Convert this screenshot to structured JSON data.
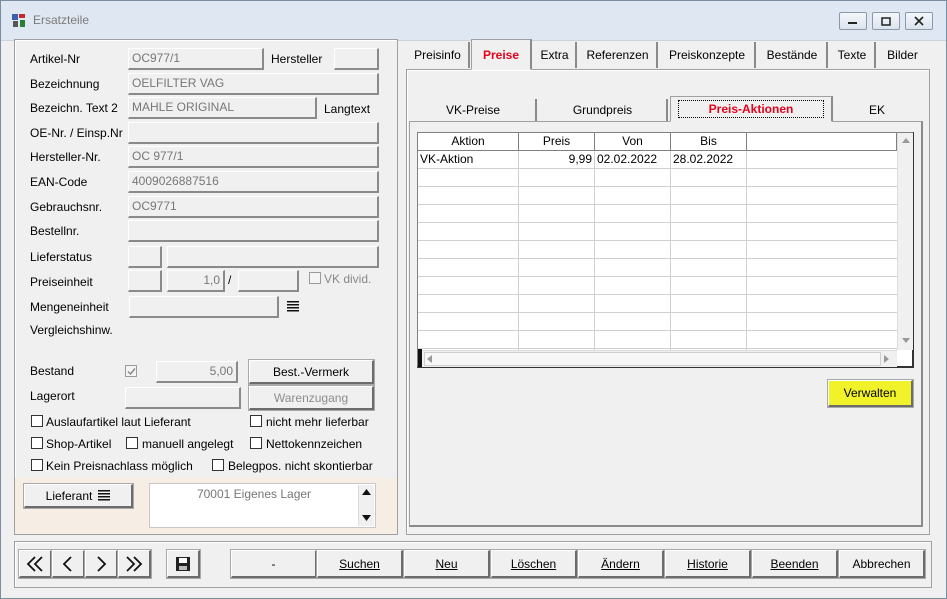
{
  "window": {
    "title": "Ersatzteile"
  },
  "left": {
    "labels": {
      "artikel_nr": "Artikel-Nr",
      "hersteller": "Hersteller",
      "bezeichnung": "Bezeichnung",
      "bezeichn_text2": "Bezeichn. Text 2",
      "langtext": "Langtext",
      "oe_nr": "OE-Nr. / Einsp.Nr",
      "hersteller_nr": "Hersteller-Nr.",
      "ean_code": "EAN-Code",
      "gebrauchsnr": "Gebrauchsnr.",
      "bestellnr": "Bestellnr.",
      "lieferstatus": "Lieferstatus",
      "preiseinheit": "Preiseinheit",
      "slash": "/",
      "vk_divid": "VK divid.",
      "mengeneinheit": "Mengeneinheit",
      "vergleichshinw": "Vergleichshinw.",
      "bestand": "Bestand",
      "lagerort": "Lagerort"
    },
    "values": {
      "artikel_nr": "OC977/1",
      "hersteller": "",
      "bezeichnung": "OELFILTER VAG",
      "bezeichn_text2": "MAHLE ORIGINAL",
      "oe_nr": "",
      "hersteller_nr": "OC 977/1",
      "ean_code": "4009026887516",
      "gebrauchsnr": "OC9771",
      "bestellnr": "",
      "lieferstatus_a": "",
      "lieferstatus_b": "",
      "preiseinheit_a": "",
      "preiseinheit_b": "1,0",
      "preiseinheit_c": "",
      "mengeneinheit": "",
      "bestand": "5,00",
      "lagerort": ""
    },
    "buttons": {
      "best_vermerk": "Best.-Vermerk",
      "warenzugang": "Warenzugang",
      "lieferant": "Lieferant"
    },
    "checkboxes": {
      "auslaufartikel": "Auslaufartikel laut Lieferant",
      "nicht_mehr_lieferbar": "nicht mehr lieferbar",
      "shop_artikel": "Shop-Artikel",
      "manuell_angelegt": "manuell angelegt",
      "nettokennzeichen": "Nettokennzeichen",
      "kein_preisnachlass": "Kein Preisnachlass möglich",
      "belegpos": "Belegpos. nicht skontierbar"
    },
    "lieferant_text": "70001 Eigenes Lager"
  },
  "tabs": [
    "Preisinfo",
    "Preise",
    "Extra",
    "Referenzen",
    "Preiskonzepte",
    "Bestände",
    "Texte",
    "Bilder"
  ],
  "price_tabs": [
    "VK-Preise",
    "Grundpreis",
    "Preis-Aktionen",
    "EK"
  ],
  "grid": {
    "columns": [
      "Aktion",
      "Preis",
      "Von",
      "Bis"
    ],
    "rows": [
      {
        "aktion": "VK-Aktion",
        "preis": "9,99",
        "von": "02.02.2022",
        "bis": "28.02.2022"
      }
    ]
  },
  "verwalten": "Verwalten",
  "bottom": {
    "dash": "-",
    "suchen": "Suchen",
    "neu": "Neu",
    "loeschen": "Löschen",
    "aendern": "Ändern",
    "historie": "Historie",
    "beenden": "Beenden",
    "abbrechen": "Abbrechen"
  },
  "colors": {
    "accent_red": "#e8001c",
    "verwalten_yellow": "#f2f22a"
  }
}
